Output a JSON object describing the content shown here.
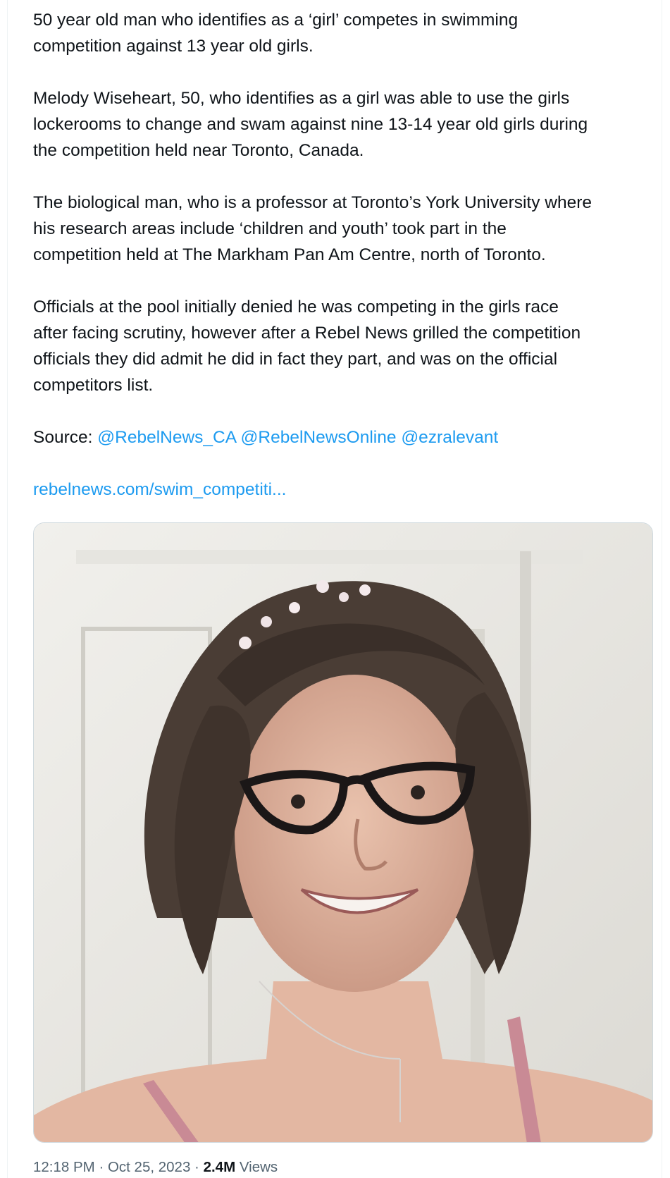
{
  "tweet": {
    "paragraphs": [
      "50 year old man who identifies as a ‘girl’ competes in swimming\ncompetition against 13 year old girls.",
      "Melody Wiseheart, 50, who identifies as a girl was able to use the girls\nlockerooms to change and swam against nine 13-14 year old girls during\nthe competition held near Toronto, Canada.",
      "The biological man, who is a professor at Toronto’s York University where\nhis research areas include ‘children and youth’ took part in the\ncompetition held at The Markham Pan Am Centre, north of Toronto.",
      "Officials at the pool initially denied he was competing in the girls race\nafter facing scrutiny, however after a Rebel News grilled the competition\nofficials they did admit he did in fact they part, and was on the official\ncompetitors list."
    ],
    "source_label": "Source:",
    "mentions": [
      "@RebelNews_CA",
      "@RebelNewsOnline",
      "@ezralevant"
    ],
    "url_text": "rebelnews.com/swim_competiti...",
    "image_desc_icon": "portrait-photo",
    "timestamp": "12:18 PM · Oct 25, 2023 · ",
    "views_count": "2.4M",
    "views_label": " Views",
    "colors": {
      "link": "#1d9bf0",
      "text": "#0f1419",
      "muted": "#536471"
    }
  }
}
